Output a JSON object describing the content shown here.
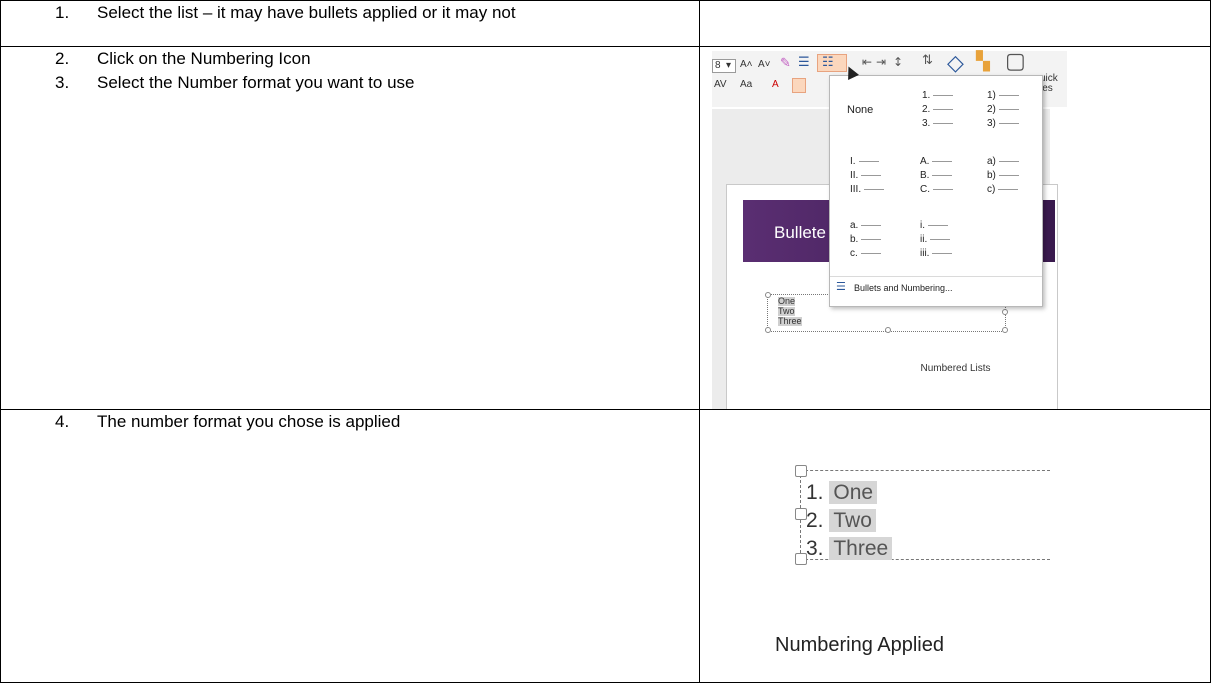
{
  "steps": [
    {
      "num": "1.",
      "text": "Select the list – it may have bullets applied or it may not"
    },
    {
      "num": "2.",
      "text": "Click on the Numbering Icon"
    },
    {
      "num": "3.",
      "text": "Select the Number format you want to use"
    },
    {
      "num": "4.",
      "text": "The number format you chose is applied"
    }
  ],
  "shot1": {
    "caption": "Numbered Lists",
    "slide_title_partial": "Bullete",
    "text_box_items": [
      "One",
      "Two",
      "Three"
    ],
    "ribbon_text": {
      "font_size_partial": "8",
      "grow": "A˄",
      "shrink": "A˅",
      "spacing": "AV",
      "case": "Aa",
      "color": "A",
      "quick": "uick",
      "styles": "les"
    },
    "menu": {
      "none_label": "None",
      "col1": [
        "1.",
        "2.",
        "3."
      ],
      "col2": [
        "1)",
        "2)",
        "3)"
      ],
      "roman": [
        "I.",
        "II.",
        "III."
      ],
      "upper": [
        "A.",
        "B.",
        "C."
      ],
      "lower_paren": [
        "a)",
        "b)",
        "c)"
      ],
      "lower_dot": [
        "a.",
        "b.",
        "c."
      ],
      "lower_roman": [
        "i.",
        "ii.",
        "iii."
      ],
      "footer": "Bullets and Numbering..."
    }
  },
  "shot2": {
    "items": [
      {
        "num": "1.",
        "text": "One"
      },
      {
        "num": "2.",
        "text": "Two"
      },
      {
        "num": "3.",
        "text": "Three"
      }
    ],
    "caption": "Numbering Applied"
  }
}
